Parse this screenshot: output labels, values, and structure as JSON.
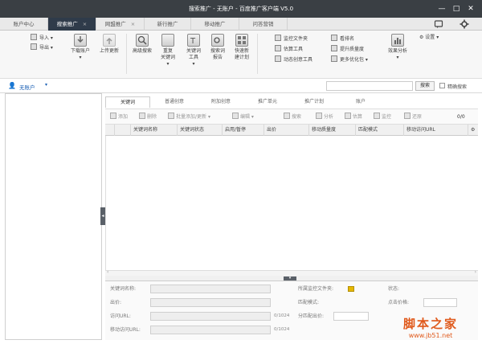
{
  "window": {
    "title": "搜索推广 - 无账户 - 百度推广客户端 V5.0",
    "minimize": "—",
    "maximize": "□",
    "close": "✕"
  },
  "tabs": [
    {
      "label": "账户中心",
      "closable": false
    },
    {
      "label": "搜索推广",
      "closable": true,
      "active": true
    },
    {
      "label": "网盟推广",
      "closable": true
    },
    {
      "label": "新行推广",
      "closable": false
    },
    {
      "label": "移动推广",
      "closable": false
    },
    {
      "label": "问答营销",
      "closable": false
    }
  ],
  "tab_close_glyph": "×",
  "ribbon": {
    "import_label": "导入",
    "export_label": "导出",
    "download_account": "下载账户",
    "upload_update": "上传更新",
    "advanced_search": "高级搜索",
    "dedupe_keyword_line1": "重复",
    "dedupe_keyword_line2": "关键词",
    "keyword_tool_line1": "关键词",
    "keyword_tool_line2": "工具",
    "search_report_line1": "搜索词",
    "search_report_line2": "报告",
    "quick_plan_line1": "快速新",
    "quick_plan_line2": "建计划",
    "monitor_folder": "监控文件夹",
    "estimate_tool": "估算工具",
    "dynamic_creative": "动态创意工具",
    "rank_label": "看排名",
    "quality_label": "提升质量度",
    "more_optimize": "更多优化包",
    "effect_analysis": "效果分析",
    "settings_label": "设置"
  },
  "account": {
    "name": "无账户",
    "search_button": "搜索",
    "precise_search": "精确搜索",
    "search_value": ""
  },
  "subtabs": [
    "关键词",
    "普通创意",
    "附加创意",
    "推广单元",
    "推广计划",
    "账户"
  ],
  "toolbar": {
    "add": "添加",
    "delete": "删除",
    "batch": "批量添加/更新",
    "edit": "编辑",
    "search": "搜索",
    "analyze": "分析",
    "estimate": "估算",
    "monitor": "监控",
    "restore": "还原",
    "count": "0/0"
  },
  "columns": [
    "关键词名称",
    "关键词状态",
    "启用/暂停",
    "出价",
    "移动质量度",
    "匹配模式",
    "移动访问URL"
  ],
  "detail": {
    "keyword_name_label": "关键词名称:",
    "bid_label": "出价:",
    "url_label": "访问URL:",
    "mobile_url_label": "移动访问URL:",
    "url_count": "0/1024",
    "mobile_url_count": "0/1024",
    "folder_label": "所属监控文件夹:",
    "status_label": "状态:",
    "match_label": "匹配模式:",
    "segment_label": "分匹配出价:",
    "quality_label": "点击价格:"
  },
  "watermark": {
    "main": "脚本之家",
    "url": "www.jb51.net"
  }
}
